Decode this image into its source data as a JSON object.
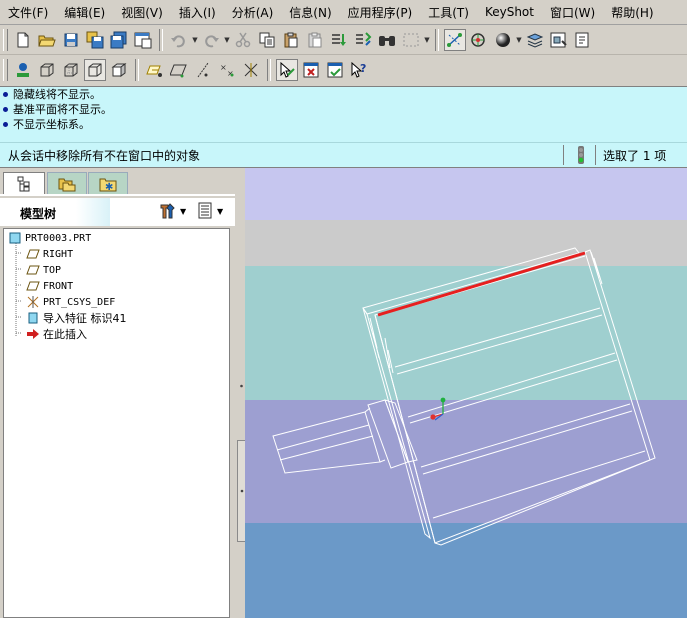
{
  "menubar": {
    "items": [
      "文件(F)",
      "编辑(E)",
      "视图(V)",
      "插入(I)",
      "分析(A)",
      "信息(N)",
      "应用程序(P)",
      "工具(T)",
      "KeyShot",
      "窗口(W)",
      "帮助(H)"
    ]
  },
  "messages": {
    "lines": [
      "隐藏线将不显示。",
      "基准平面将不显示。",
      "不显示坐标系。"
    ]
  },
  "status": {
    "message": "从会话中移除所有不在窗口中的对象",
    "selection": "选取了 1 项"
  },
  "model_tree": {
    "title": "模型树",
    "items": [
      "PRT0003.PRT",
      "RIGHT",
      "TOP",
      "FRONT",
      "PRT_CSYS_DEF",
      "导入特征 标识41",
      "在此插入"
    ]
  },
  "colors": {
    "message_bg": "#c8f6fa",
    "highlight_edge": "#e62020",
    "panel_bg": "#d4d0c8"
  }
}
